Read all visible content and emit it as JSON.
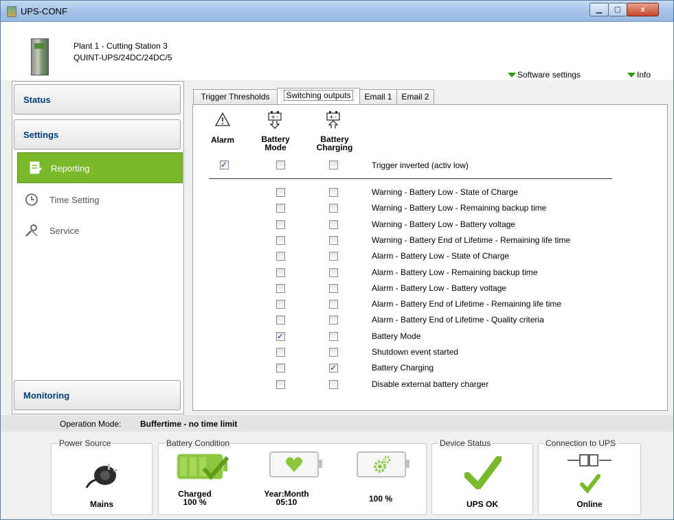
{
  "window": {
    "title": "UPS-CONF",
    "minimize": "▁",
    "maximize": "▢",
    "close": "x"
  },
  "header": {
    "device_name": "Plant 1 - Cutting Station 3",
    "device_model": "QUINT-UPS/24DC/24DC/5",
    "software_settings": "Software settings",
    "info": "Info"
  },
  "sidebar": {
    "status": "Status",
    "settings": "Settings",
    "items": [
      {
        "label": "Reporting",
        "icon": "report-icon",
        "active": true
      },
      {
        "label": "Time Setting",
        "icon": "clock-icon",
        "active": false
      },
      {
        "label": "Service",
        "icon": "tools-icon",
        "active": false
      }
    ],
    "monitoring": "Monitoring"
  },
  "tabs": [
    "Trigger Thresholds",
    "Switching outputs",
    "Email 1",
    "Email 2"
  ],
  "active_tab": "Switching outputs",
  "columns": {
    "alarm": "Alarm",
    "battery_mode": [
      "Battery",
      "Mode"
    ],
    "battery_charging": [
      "Battery",
      "Charging"
    ]
  },
  "trigger": {
    "label": "Trigger inverted (activ low)",
    "alarm": true,
    "battery_mode": false,
    "battery_charging": false
  },
  "rows": [
    {
      "label": "Warning - Battery Low - State of Charge",
      "battery_mode": false,
      "battery_charging": false
    },
    {
      "label": "Warning - Battery Low - Remaining backup time",
      "battery_mode": false,
      "battery_charging": false
    },
    {
      "label": "Warning - Battery Low - Battery voltage",
      "battery_mode": false,
      "battery_charging": false
    },
    {
      "label": "Warning - Battery End of Lifetime - Remaining life time",
      "battery_mode": false,
      "battery_charging": false
    },
    {
      "label": "Alarm - Battery Low - State of Charge",
      "battery_mode": false,
      "battery_charging": false
    },
    {
      "label": "Alarm - Battery Low - Remaining backup time",
      "battery_mode": false,
      "battery_charging": false
    },
    {
      "label": "Alarm - Battery Low - Battery voltage",
      "battery_mode": false,
      "battery_charging": false
    },
    {
      "label": "Alarm - Battery End of Lifetime - Remaining life time",
      "battery_mode": false,
      "battery_charging": false
    },
    {
      "label": "Alarm - Battery End of Lifetime - Quality criteria",
      "battery_mode": false,
      "battery_charging": false
    },
    {
      "label": "Battery Mode",
      "battery_mode": true,
      "battery_charging": false
    },
    {
      "label": "Shutdown event started",
      "battery_mode": false,
      "battery_charging": false
    },
    {
      "label": "Battery Charging",
      "battery_mode": false,
      "battery_charging": true
    },
    {
      "label": "Disable external battery charger",
      "battery_mode": false,
      "battery_charging": false
    }
  ],
  "operation_mode": {
    "label": "Operation Mode:",
    "value": "Buffertime - no time limit"
  },
  "status_panels": {
    "power_source": {
      "title": "Power Source",
      "value": "Mains"
    },
    "battery_condition": {
      "title": "Battery Condition",
      "charged_label": "Charged",
      "charged_value": "100 %",
      "lifetime_label": "Year:Month",
      "lifetime_value": "05:10",
      "quality_value": "100 %"
    },
    "device_status": {
      "title": "Device Status",
      "value": "UPS OK"
    },
    "connection": {
      "title": "Connection to UPS",
      "value": "Online"
    }
  },
  "colors": {
    "accent_green": "#7ab929",
    "link_green": "#21a000",
    "title_blue": "#003b7a"
  }
}
